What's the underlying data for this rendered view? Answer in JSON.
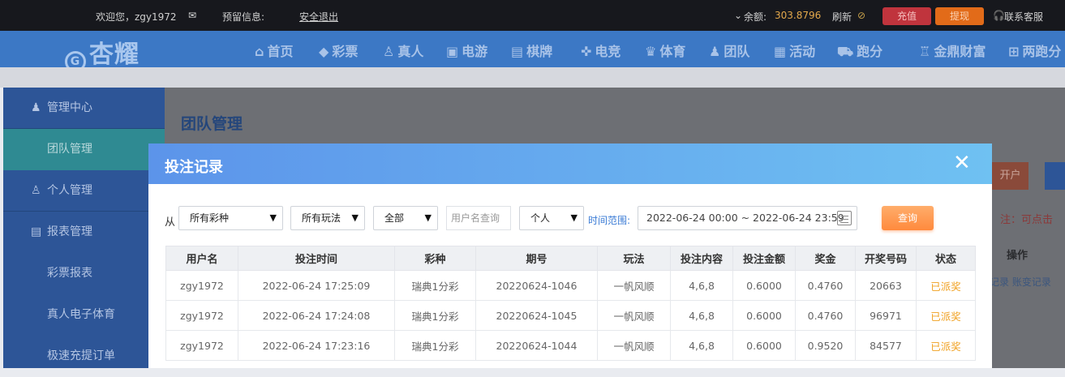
{
  "topbar": {
    "welcome": "欢迎您，zgy1972",
    "notice_label": "预留信息:",
    "logout": "安全退出",
    "balance_label": "余额:",
    "balance": "303.8796",
    "refresh": "刷新",
    "recharge": "充值",
    "withdraw": "提现",
    "support": "联系客服"
  },
  "nav": {
    "logo": "杏耀",
    "items": [
      "首页",
      "彩票",
      "真人",
      "电游",
      "棋牌",
      "电竞",
      "体育",
      "团队",
      "活动",
      "跑分",
      "金鼎财富",
      "两跑分"
    ]
  },
  "sidebar": {
    "items": [
      "管理中心",
      "团队管理",
      "个人管理",
      "报表管理",
      "彩票报表",
      "真人电子体育",
      "极速充提订单"
    ]
  },
  "background": {
    "page_title": "团队管理",
    "open_account": "开户",
    "note": "注：可点击",
    "op_header": "操作",
    "links": "记录 账变记录"
  },
  "modal": {
    "title": "投注记录",
    "from_label": "从",
    "lottery_select": "所有彩种",
    "play_select": "所有玩法",
    "status_select": "全部",
    "username_placeholder": "用户名查询",
    "scope_select": "个人",
    "time_label": "时间范围:",
    "time_range": "2022-06-24 00:00 ~ 2022-06-24 23:59",
    "query_button": "查询",
    "columns": [
      "用户名",
      "投注时间",
      "彩种",
      "期号",
      "玩法",
      "投注内容",
      "投注金额",
      "奖金",
      "开奖号码",
      "状态"
    ],
    "rows": [
      [
        "zgy1972",
        "2022-06-24 17:25:09",
        "瑞典1分彩",
        "20220624-1046",
        "一帆风顺",
        "4,6,8",
        "0.6000",
        "0.4760",
        "20663",
        "已派奖"
      ],
      [
        "zgy1972",
        "2022-06-24 17:24:08",
        "瑞典1分彩",
        "20220624-1045",
        "一帆风顺",
        "4,6,8",
        "0.6000",
        "0.4760",
        "96971",
        "已派奖"
      ],
      [
        "zgy1972",
        "2022-06-24 17:23:16",
        "瑞典1分彩",
        "20220624-1044",
        "一帆风顺",
        "4,6,8",
        "0.6000",
        "0.9520",
        "84577",
        "已派奖"
      ]
    ]
  },
  "colors": {
    "topbar_bg": "#17181d",
    "nav_bg": "#3c78c5",
    "sidebar_bg": "#2d5597",
    "sidebar_active": "#2f8a92",
    "modal_header_start": "#5c94ea",
    "modal_header_end": "#6fc1f2",
    "status_paid": "#f0a020",
    "query_button": "#ff8a3d"
  }
}
